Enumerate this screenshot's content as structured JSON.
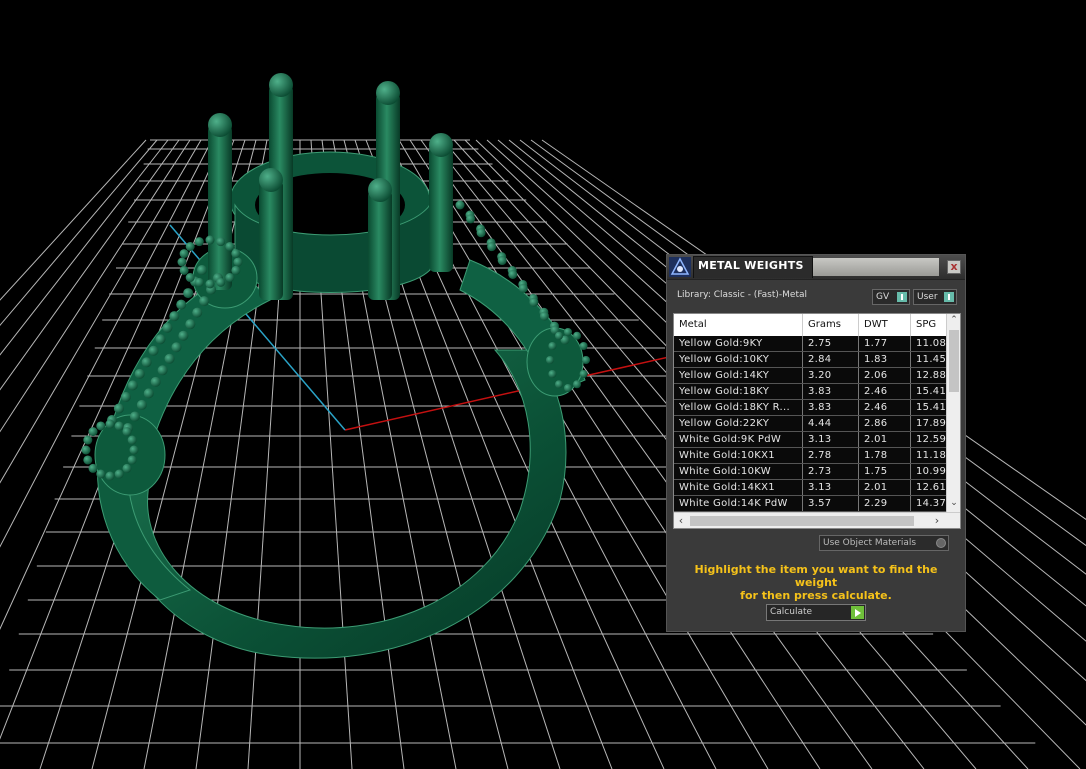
{
  "panel": {
    "title": "METAL WEIGHTS",
    "close_glyph": "x",
    "library_label": "Library: Classic - (Fast)-Metal",
    "gv_toggle": "GV",
    "user_toggle": "User",
    "columns": [
      "Metal",
      "Grams",
      "DWT",
      "SPG"
    ],
    "rows": [
      [
        "Yellow Gold:9KY",
        "2.75",
        "1.77",
        "11.08"
      ],
      [
        "Yellow Gold:10KY",
        "2.84",
        "1.83",
        "11.45"
      ],
      [
        "Yellow Gold:14KY",
        "3.20",
        "2.06",
        "12.88"
      ],
      [
        "Yellow Gold:18KY",
        "3.83",
        "2.46",
        "15.41"
      ],
      [
        "Yellow Gold:18KY R...",
        "3.83",
        "2.46",
        "15.41"
      ],
      [
        "Yellow Gold:22KY",
        "4.44",
        "2.86",
        "17.89"
      ],
      [
        "White Gold:9K PdW",
        "3.13",
        "2.01",
        "12.59"
      ],
      [
        "White Gold:10KX1",
        "2.78",
        "1.78",
        "11.18"
      ],
      [
        "White Gold:10KW",
        "2.73",
        "1.75",
        "10.99"
      ],
      [
        "White Gold:14KX1",
        "3.13",
        "2.01",
        "12.61"
      ],
      [
        "White Gold:14K PdW",
        "3.57",
        "2.29",
        "14.37"
      ]
    ],
    "use_materials": "Use Object Materials",
    "hint_line1": "Highlight the item you want to find the weight",
    "hint_line2": "for then press calculate.",
    "calculate_label": "Calculate"
  },
  "colors": {
    "model": "#0d5a3c",
    "grid": "#d8d8d8",
    "x_axis": "#c41010",
    "y_axis": "#2aa3c7",
    "hint": "#f5c21a"
  },
  "icons": {
    "app": "matrix-logo-icon",
    "close": "close-icon",
    "calculate": "play-icon"
  }
}
